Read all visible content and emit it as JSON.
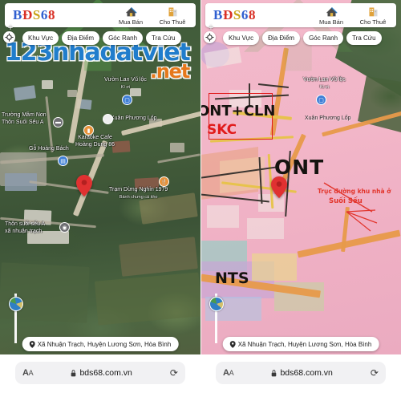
{
  "site": {
    "logo_parts": [
      "B",
      "Đ",
      "S",
      "6",
      "8"
    ],
    "logo_text": "BĐS68",
    "watermark_main": "123nhadatviet",
    "watermark_tld": ".net"
  },
  "header": {
    "actions": [
      {
        "label": "Mua Bán",
        "icon": "house-sale-icon"
      },
      {
        "label": "Cho Thuê",
        "icon": "building-rent-icon"
      }
    ]
  },
  "filters": {
    "pills": [
      {
        "label": "Khu Vực"
      },
      {
        "label": "Địa Điểm"
      },
      {
        "label": "Góc Ranh"
      },
      {
        "label": "Tra Cứu"
      }
    ],
    "zoom_in": "+",
    "zoom_out": "−",
    "locate_icon": "crosshair-icon"
  },
  "left_map": {
    "view": "satellite",
    "pois": [
      {
        "name": "Vườn Lan Vũ lộc",
        "sub": "Kí ơi"
      },
      {
        "name": "Xuân Phương Lốp",
        "sub": ""
      },
      {
        "name": "Trường Mầm Non",
        "sub": "Thôn Suối Sếu A"
      },
      {
        "name": "Karaoke Cafe",
        "sub": "Hoàng Dung 86"
      },
      {
        "name": "Gỗ Hoàng Bách",
        "sub": ""
      },
      {
        "name": "Trạm Dừng Nghỉn 1979",
        "sub": "Bánh chưng cá kho"
      },
      {
        "name": "Thôn suối sếu A",
        "sub": "xã nhuận trạch"
      }
    ],
    "marker": "red-location-pin"
  },
  "right_map": {
    "view": "zoning-plan",
    "annotations": [
      {
        "text": "ONT+CLN",
        "style": "dark"
      },
      {
        "text": "SKC",
        "style": "red"
      },
      {
        "text": "ONT",
        "style": "dark"
      },
      {
        "text": "NTS",
        "style": "dark"
      },
      {
        "text": "Trục đường khu nhà ở",
        "style": "red-small"
      },
      {
        "text": "Suối Sếu",
        "style": "red-small"
      }
    ],
    "pois": [
      {
        "name": "Vườn Lan Vũ lộc",
        "sub": "Kí ơi"
      },
      {
        "name": "Xuân Phương Lốp",
        "sub": ""
      }
    ],
    "marker": "red-location-pin"
  },
  "address": {
    "pin_icon": "map-pin-icon",
    "text": "Xã Nhuận Trạch, Huyện Lương Sơn, Hòa Bình"
  },
  "browser": {
    "text_size_label": "AA",
    "lock_icon": "lock-icon",
    "url": "bds68.com.vn",
    "reload_icon": "reload-icon"
  },
  "colors": {
    "logo_blue": "#2f5fd0",
    "logo_red": "#d93025",
    "logo_gold": "#c8a317",
    "watermark_blue": "#1f7fd4",
    "watermark_orange": "#ef7a1a",
    "pin_red": "#e03131",
    "zone_pink": "#f0a8c0",
    "annotation_red": "#e11b1b"
  }
}
